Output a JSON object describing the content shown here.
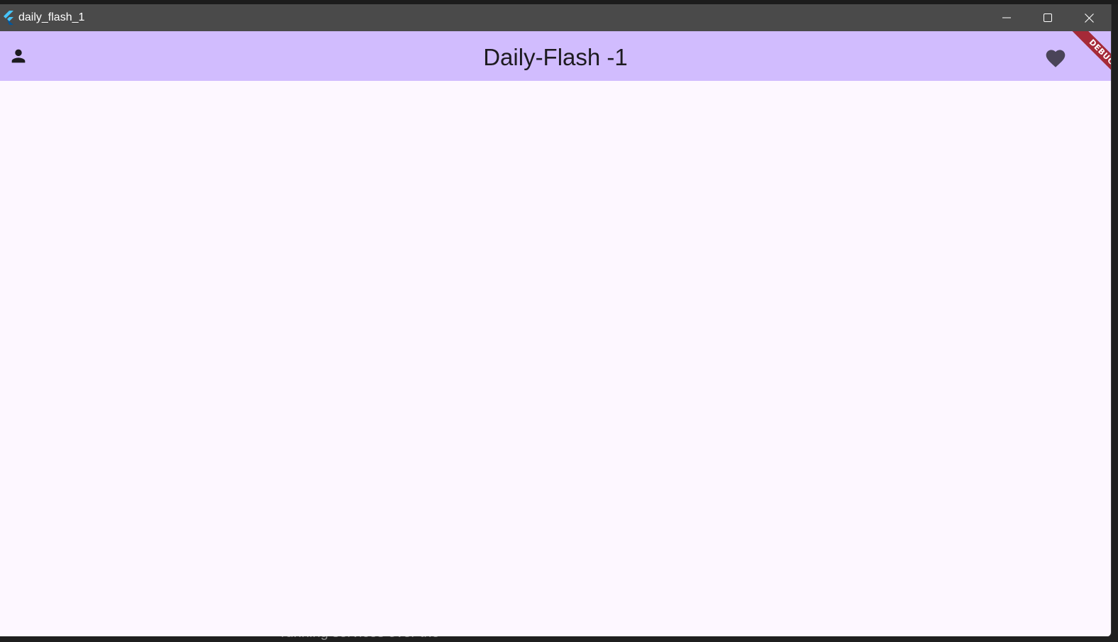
{
  "window": {
    "title": "daily_flash_1"
  },
  "appbar": {
    "title": "Daily-Flash -1",
    "leading_icon": "person-icon",
    "trailing_icon": "heart-icon",
    "background": "#d1bcfe"
  },
  "debug_banner": {
    "label": "DEBUG",
    "color": "#a52a38"
  },
  "background_window": {
    "partial_text": "running services over the"
  }
}
